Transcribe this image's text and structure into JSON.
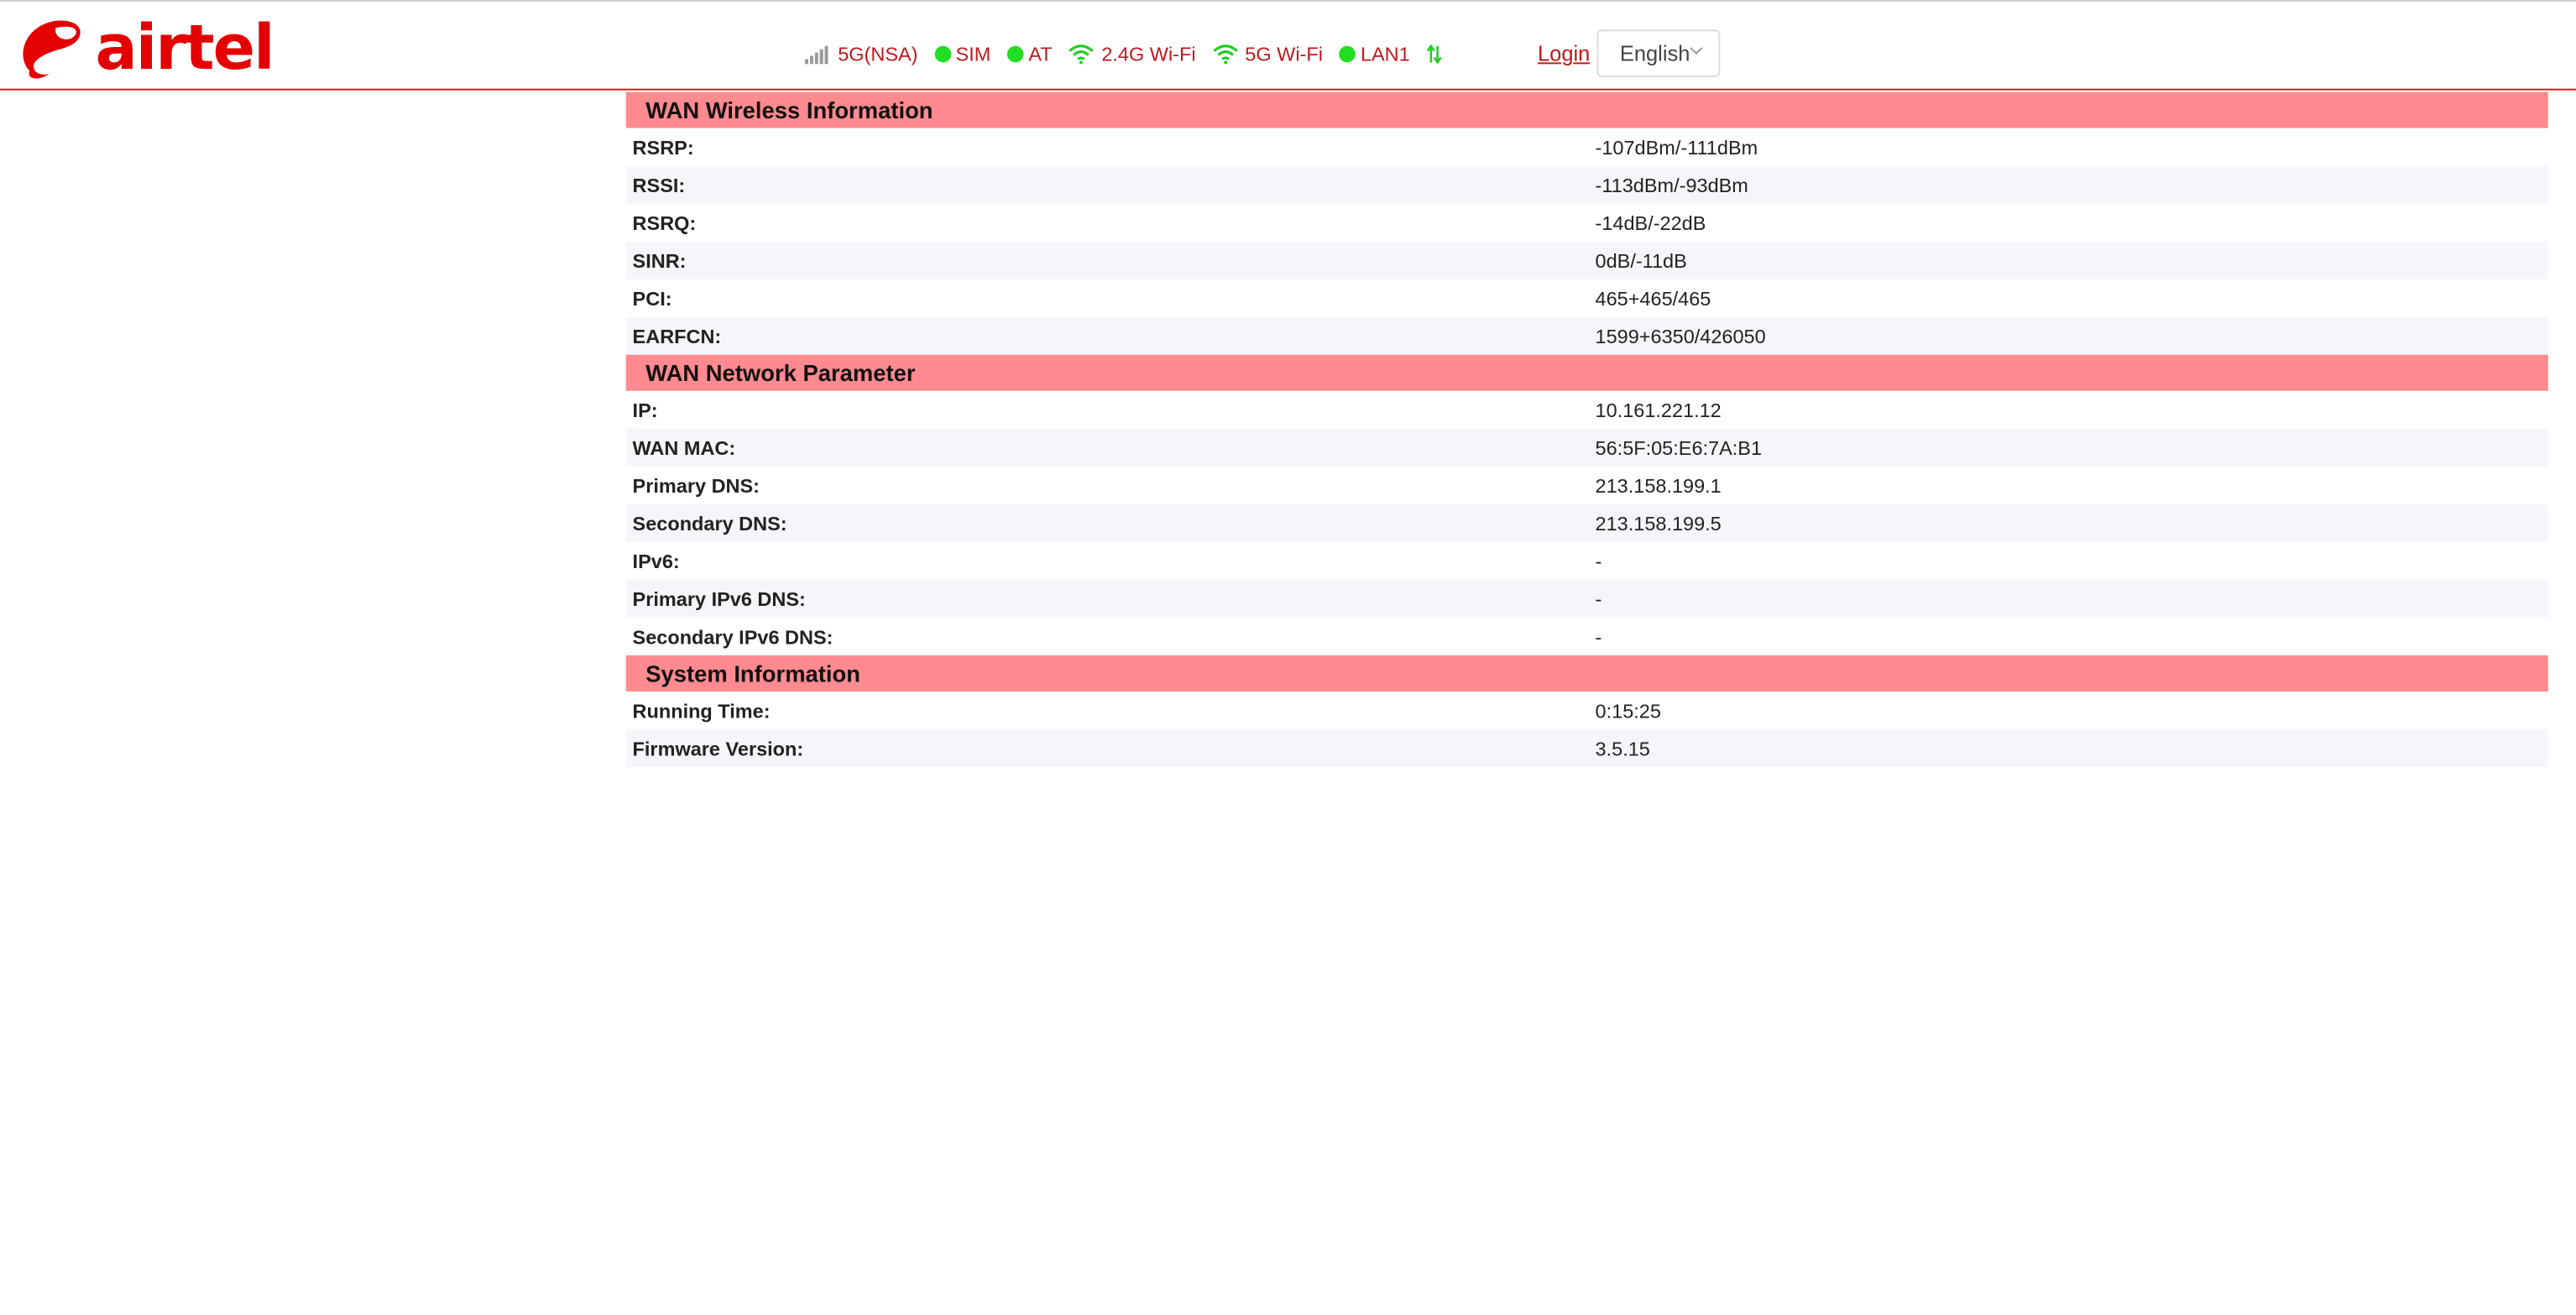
{
  "brand": {
    "name": "airtel",
    "color": "#e40000"
  },
  "status": {
    "network": "5G(NSA)",
    "sim": "SIM",
    "at": "AT",
    "wifi24": "2.4G Wi-Fi",
    "wifi5": "5G Wi-Fi",
    "lan": "LAN1"
  },
  "header": {
    "login": "Login",
    "language": "English"
  },
  "sections": [
    {
      "title": "WAN Wireless Information",
      "rows": [
        {
          "label": "RSRP:",
          "value": "-107dBm/-111dBm"
        },
        {
          "label": "RSSI:",
          "value": "-113dBm/-93dBm"
        },
        {
          "label": "RSRQ:",
          "value": "-14dB/-22dB"
        },
        {
          "label": "SINR:",
          "value": "0dB/-11dB"
        },
        {
          "label": "PCI:",
          "value": "465+465/465"
        },
        {
          "label": "EARFCN:",
          "value": "1599+6350/426050"
        }
      ]
    },
    {
      "title": "WAN Network Parameter",
      "rows": [
        {
          "label": "IP:",
          "value": "10.161.221.12"
        },
        {
          "label": "WAN MAC:",
          "value": "56:5F:05:E6:7A:B1"
        },
        {
          "label": "Primary DNS:",
          "value": "213.158.199.1"
        },
        {
          "label": "Secondary DNS:",
          "value": "213.158.199.5"
        },
        {
          "label": "IPv6:",
          "value": "-"
        },
        {
          "label": "Primary IPv6 DNS:",
          "value": "-"
        },
        {
          "label": "Secondary IPv6 DNS:",
          "value": "-"
        }
      ]
    },
    {
      "title": "System Information",
      "rows": [
        {
          "label": "Running Time:",
          "value": "0:15:25"
        },
        {
          "label": "Firmware Version:",
          "value": "3.5.15"
        }
      ]
    }
  ],
  "colors": {
    "accent": "#c0171d",
    "section_header": "#ff8a8f",
    "status_ok": "#22dd22"
  },
  "icons": [
    "airtel-logo-icon",
    "signal-icon",
    "wifi-icon",
    "chevron-down-icon",
    "transfer-arrows-icon"
  ]
}
